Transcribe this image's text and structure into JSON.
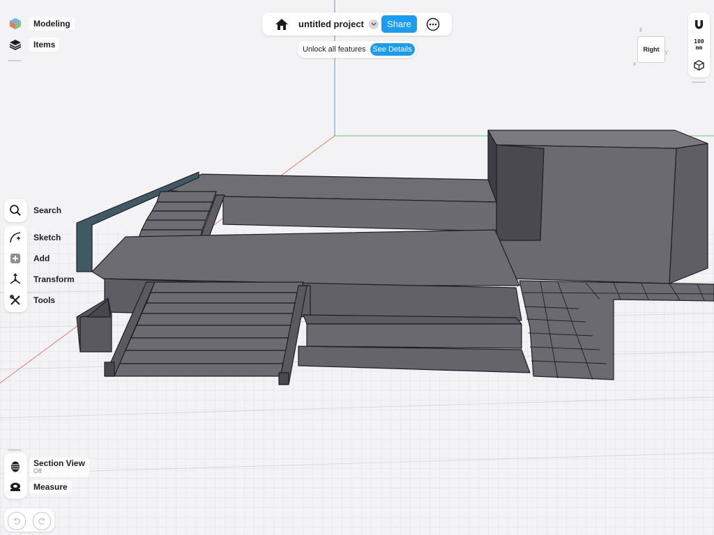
{
  "top_bar": {
    "project_title": "untitled project",
    "share_label": "Share",
    "unlock_text": "Unlock all features",
    "details_label": "See Details"
  },
  "left_top": {
    "modeling_label": "Modeling",
    "items_label": "Items"
  },
  "left_tools": {
    "search_label": "Search",
    "sketch_label": "Sketch",
    "add_label": "Add",
    "transform_label": "Transform",
    "tools_label": "Tools"
  },
  "left_bottom": {
    "section_view_label": "Section View",
    "section_view_state": "Off",
    "measure_label": "Measure"
  },
  "right_panel": {
    "unit_value": "100",
    "unit_suffix": "mm"
  },
  "view_cube": {
    "face_label": "Right",
    "axis_z": "z",
    "axis_y": "y",
    "axis_x": "x"
  },
  "colors": {
    "accent": "#1a9cf0",
    "background": "#f3f3f5",
    "model_face": "#6b6a70",
    "model_dark": "#48474d",
    "model_edge": "#1e1e22",
    "glass": "#3f5a64",
    "grid": "#d4d5db",
    "axis_red": "#e07a6e",
    "axis_green": "#6fc27f",
    "axis_blue": "#6a8ee0"
  },
  "icons": {
    "home": "home-icon",
    "more": "more-icon",
    "chevron": "chevron-down-icon",
    "magnet": "magnet-icon",
    "orient": "orientation-icon"
  }
}
